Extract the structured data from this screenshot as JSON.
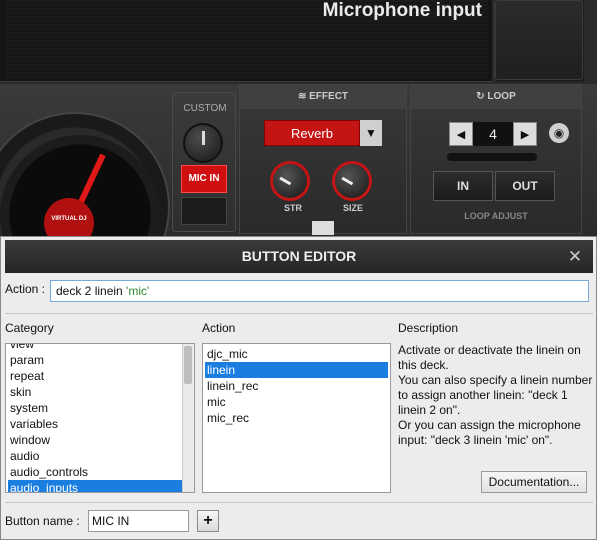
{
  "deck": {
    "display_title": "Microphone input",
    "custom_label": "CUSTOM",
    "mic_in_label": "MIC IN",
    "platter_logo": "VIRTUAL DJ",
    "effect": {
      "header": "EFFECT",
      "selected": "Reverb",
      "knob_left_label": "STR",
      "knob_right_label": "SIZE"
    },
    "loop": {
      "header": "LOOP",
      "count": "4",
      "in_label": "IN",
      "out_label": "OUT",
      "adjust_label": "LOOP ADJUST"
    }
  },
  "dialog": {
    "title": "BUTTON EDITOR",
    "close_glyph": "✕",
    "action_label": "Action :",
    "action_value_plain": "deck 2 linein ",
    "action_value_quoted": "'mic'",
    "category_header": "Category",
    "action_header": "Action",
    "description_header": "Description",
    "categories": [
      "view",
      "param",
      "repeat",
      "skin",
      "system",
      "variables",
      "window",
      "audio",
      "audio_controls",
      "audio_inputs"
    ],
    "selected_category": "audio_inputs",
    "actions": [
      "djc_mic",
      "linein",
      "linein_rec",
      "mic",
      "mic_rec"
    ],
    "selected_action": "linein",
    "description": "Activate or deactivate the linein on this deck.\nYou can also specify a linein number to assign another linein: \"deck 1 linein 2 on\".\nOr you can assign the microphone input: \"deck 3 linein 'mic' on\".",
    "documentation_button": "Documentation...",
    "button_name_label": "Button name :",
    "button_name_value": "MIC IN",
    "add_glyph": "+"
  },
  "colors": {
    "selection_blue": "#1a7ee0",
    "mic_red": "#d01010",
    "quoted_green": "#2f8a2f"
  },
  "icons": {
    "effect": "waveform-icon",
    "loop": "loop-arrows-icon",
    "close": "close-icon",
    "add": "plus-icon"
  }
}
